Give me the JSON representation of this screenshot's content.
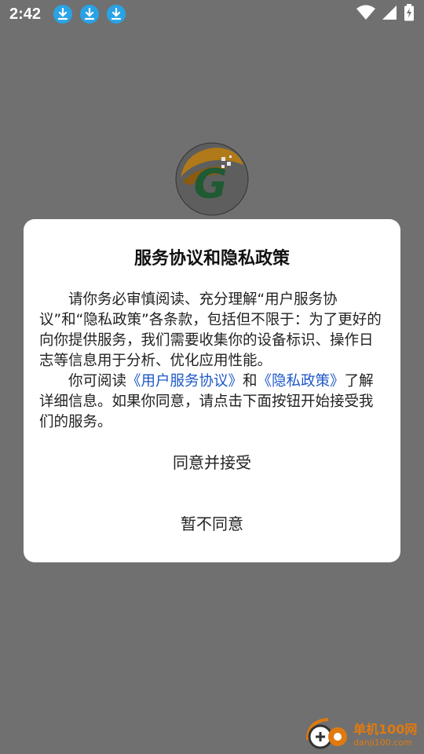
{
  "status_bar": {
    "time": "2:42",
    "icons": [
      "download-icon",
      "download-icon",
      "download-icon",
      "wifi-icon",
      "signal-icon",
      "battery-charging-icon"
    ]
  },
  "app_logo": {
    "icon": "app-logo-icon",
    "letter": "G"
  },
  "dialog": {
    "title": "服务协议和隐私政策",
    "paragraph1": "请你务必审慎阅读、充分理解“用户服务协议”和“隐私政策”各条款，包括但不限于：为了更好的向你提供服务，我们需要收集你的设备标识、操作日志等信息用于分析、优化应用性能。",
    "paragraph2_prefix": "你可阅读",
    "link_service": "《用户服务协议》",
    "paragraph2_and": "和",
    "link_privacy": "《隐私政策》",
    "paragraph2_suffix": "了解详细信息。如果你同意，请点击下面按钮开始接受我们的服务。",
    "accept_label": "同意并接受",
    "decline_label": "暂不同意"
  },
  "watermark": {
    "main": "单机100网",
    "sub": "danji100.com"
  },
  "colors": {
    "overlay": "#707070",
    "link": "#1e58c8",
    "download_badge": "#29a3e6",
    "watermark": "#e07a10"
  }
}
